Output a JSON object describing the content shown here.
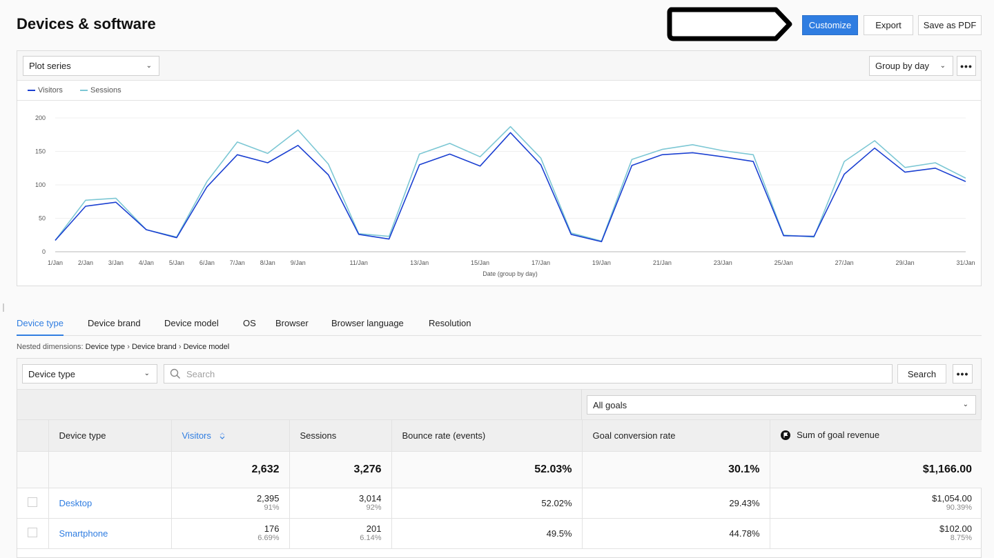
{
  "header": {
    "title": "Devices & software",
    "buttons": {
      "customize": "Customize",
      "export": "Export",
      "save_pdf": "Save as PDF"
    }
  },
  "chart_panel": {
    "plot_series_select": "Plot series",
    "group_by_select": "Group by day",
    "more_icon": "more-horizontal-icon"
  },
  "colors": {
    "accent": "#2f7de1",
    "visitors": "#1a3fd1",
    "sessions": "#7cc7d4"
  },
  "chart_data": {
    "type": "line",
    "title": "",
    "xlabel": "Date (group by day)",
    "ylabel": "",
    "ylim": [
      0,
      200
    ],
    "yticks": [
      0,
      50,
      100,
      150,
      200
    ],
    "grid": true,
    "legend_position": "top-left",
    "x": [
      "1/Jan",
      "2/Jan",
      "3/Jan",
      "4/Jan",
      "5/Jan",
      "6/Jan",
      "7/Jan",
      "8/Jan",
      "9/Jan",
      "10/Jan",
      "11/Jan",
      "12/Jan",
      "13/Jan",
      "14/Jan",
      "15/Jan",
      "16/Jan",
      "17/Jan",
      "18/Jan",
      "19/Jan",
      "20/Jan",
      "21/Jan",
      "22/Jan",
      "23/Jan",
      "24/Jan",
      "25/Jan",
      "26/Jan",
      "27/Jan",
      "28/Jan",
      "29/Jan",
      "30/Jan",
      "31/Jan"
    ],
    "xtick_labels": [
      "1/Jan",
      "2/Jan",
      "3/Jan",
      "4/Jan",
      "5/Jan",
      "6/Jan",
      "7/Jan",
      "8/Jan",
      "9/Jan",
      "",
      "11/Jan",
      "",
      "13/Jan",
      "",
      "15/Jan",
      "",
      "17/Jan",
      "",
      "19/Jan",
      "",
      "21/Jan",
      "",
      "23/Jan",
      "",
      "25/Jan",
      "",
      "27/Jan",
      "",
      "29/Jan",
      "",
      "31/Jan"
    ],
    "series": [
      {
        "name": "Visitors",
        "values": [
          17,
          68,
          74,
          33,
          21,
          97,
          145,
          133,
          159,
          115,
          26,
          19,
          130,
          146,
          128,
          178,
          130,
          26,
          15,
          129,
          145,
          148,
          142,
          135,
          24,
          23,
          116,
          155,
          119,
          125,
          105
        ]
      },
      {
        "name": "Sessions",
        "values": [
          17,
          77,
          80,
          33,
          22,
          105,
          164,
          147,
          182,
          131,
          27,
          23,
          146,
          162,
          142,
          187,
          140,
          28,
          16,
          138,
          153,
          160,
          151,
          145,
          25,
          22,
          135,
          166,
          126,
          133,
          110
        ]
      }
    ]
  },
  "tabs": [
    {
      "label": "Device type",
      "active": true
    },
    {
      "label": "Device brand",
      "active": false
    },
    {
      "label": "Device model",
      "active": false
    },
    {
      "label": "OS",
      "active": false
    },
    {
      "label": "Browser",
      "active": false
    },
    {
      "label": "Browser language",
      "active": false
    },
    {
      "label": "Resolution",
      "active": false
    }
  ],
  "nested": {
    "prefix": "Nested dimensions:",
    "path": [
      "Device type",
      "Device brand",
      "Device model"
    ],
    "separator": "›"
  },
  "table_toolbar": {
    "dimension_select": "Device type",
    "search_placeholder": "Search",
    "search_value": "",
    "search_button": "Search",
    "goals_select": "All goals"
  },
  "table": {
    "columns": [
      {
        "label": "Device type"
      },
      {
        "label": "Visitors",
        "sorted": true
      },
      {
        "label": "Sessions"
      },
      {
        "label": "Bounce rate (events)"
      },
      {
        "label": "Goal conversion rate"
      },
      {
        "label": "Sum of goal revenue",
        "icon": "goal-flag-icon"
      }
    ],
    "totals": {
      "visitors": "2,632",
      "sessions": "3,276",
      "bounce": "52.03%",
      "conversion": "30.1%",
      "revenue": "$1,166.00"
    },
    "rows": [
      {
        "name": "Desktop",
        "visitors": "2,395",
        "visitors_pct": "91%",
        "sessions": "3,014",
        "sessions_pct": "92%",
        "bounce": "52.02%",
        "conversion": "29.43%",
        "revenue": "$1,054.00",
        "revenue_pct": "90.39%"
      },
      {
        "name": "Smartphone",
        "visitors": "176",
        "visitors_pct": "6.69%",
        "sessions": "201",
        "sessions_pct": "6.14%",
        "bounce": "49.5%",
        "conversion": "44.78%",
        "revenue": "$102.00",
        "revenue_pct": "8.75%"
      }
    ]
  }
}
